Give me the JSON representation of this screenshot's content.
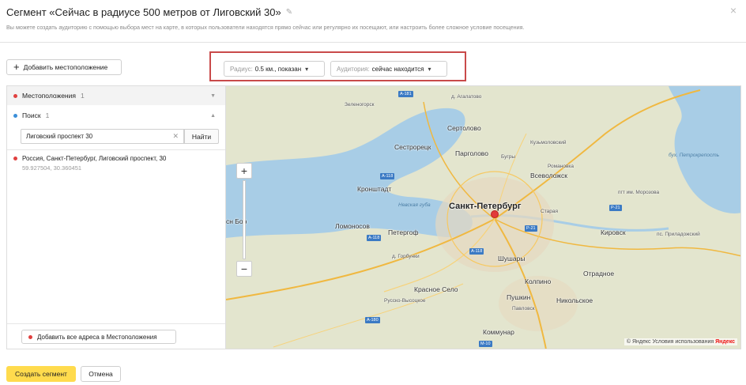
{
  "header": {
    "title": "Сегмент  «Сейчас в радиусе 500 метров от Лиговский 30»",
    "subtitle": "Вы можете создать аудиторию с помощью выбора мест на карте, в которых пользователи находятся прямо сейчас или регулярно их посещают, или настроить более сложное условие посещения.",
    "close_label": "×"
  },
  "toolbar": {
    "add_location_label": "Добавить местоположение"
  },
  "filters": {
    "radius_label": "Радиус:",
    "radius_value": "0.5 км., показан",
    "audience_label": "Аудитория:",
    "audience_value": "сейчас находится"
  },
  "panel": {
    "locations_label": "Местоположения",
    "locations_count": "1",
    "search_label": "Поиск",
    "search_count": "1",
    "search_value": "Лиговский проспект 30",
    "find_label": "Найти",
    "result_address": "Россия, Санкт-Петербург, Лиговский проспект, 30",
    "result_coords": "59.927504, 30.360451",
    "add_all_label": "Добавить все адреса в Местоположения"
  },
  "map": {
    "labels": {
      "sertolovo": "Сертолово",
      "sestroretsk": "Сестрорецк",
      "pargolovo": "Парголово",
      "vsevolozhsk": "Всеволожск",
      "kronshtadt": "Кронштадт",
      "spb": "Санкт-Петербург",
      "lomonosov": "Ломоносов",
      "petergof": "Петергоф",
      "kirovsk": "Кировск",
      "otradnoe": "Отрадное",
      "shushary": "Шушары",
      "kolpino": "Колпино",
      "krasnoe_selo": "Красное Село",
      "pushkin": "Пушкин",
      "nikolskoe": "Никольское",
      "kommunar": "Коммунар",
      "bor": "сн Бор",
      "agalatovo": "д. Агалатово",
      "kuzmolovsky": "Кузьмоловский",
      "bugry": "Бугры",
      "romanovka": "Романовка",
      "starya": "Старая",
      "pavlovsk": "Павловск",
      "gorbunki": "д. Горбунки",
      "russko": "Русско-Высоцкое",
      "prilad": "пс. Приладожский",
      "morozova": "пгт им. Морозова",
      "zelenogorsk": "Зеленогорск",
      "bay_finn": "Невская губа",
      "bay_petro": "бух. Петрокрепость"
    },
    "copyright": "© Яндекс Условия использования",
    "brand": "Яндекс",
    "zoom_in": "+",
    "zoom_out": "−"
  },
  "footer": {
    "create_label": "Создать сегмент",
    "cancel_label": "Отмена"
  },
  "colors": {
    "accent_yellow": "#ffdb4d",
    "highlight_red": "#c94a4a",
    "water": "#a8cde6",
    "land": "#e9e4d8",
    "marker": "#e23b3b",
    "location_dot": "#e0403f",
    "search_dot": "#3b8fd9"
  }
}
